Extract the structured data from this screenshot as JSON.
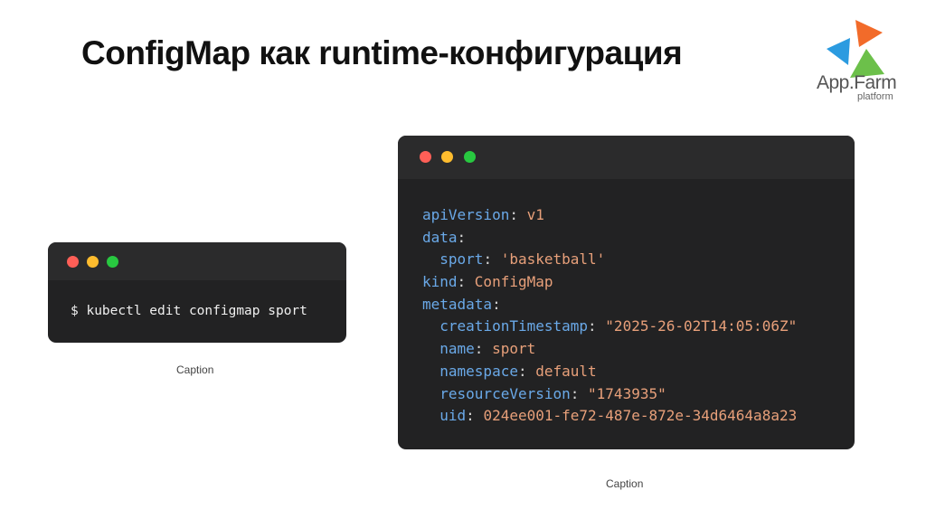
{
  "slide": {
    "title": "ConfigMap как runtime-конфигурация"
  },
  "logo": {
    "name": "App.Farm",
    "subtitle": "platform",
    "colors": {
      "orange": "#f26b2a",
      "blue": "#2b9be0",
      "green": "#6cc04a"
    }
  },
  "terminal": {
    "command": "$ kubectl edit configmap sport",
    "caption": "Caption"
  },
  "code_window": {
    "caption": "Caption",
    "lines": [
      {
        "indent": "",
        "key": "apiVersion",
        "sep": ": ",
        "value": "v1"
      },
      {
        "indent": "",
        "key": "data",
        "sep": ":",
        "value": ""
      },
      {
        "indent": "  ",
        "key": "sport",
        "sep": ": ",
        "value": "'basketball'"
      },
      {
        "indent": "",
        "key": "kind",
        "sep": ": ",
        "value": "ConfigMap"
      },
      {
        "indent": "",
        "key": "metadata",
        "sep": ":",
        "value": ""
      },
      {
        "indent": "  ",
        "key": "creationTimestamp",
        "sep": ": ",
        "value": "\"2025-26-02T14:05:06Z\""
      },
      {
        "indent": "  ",
        "key": "name",
        "sep": ": ",
        "value": "sport"
      },
      {
        "indent": "  ",
        "key": "namespace",
        "sep": ": ",
        "value": "default"
      },
      {
        "indent": "  ",
        "key": "resourceVersion",
        "sep": ": ",
        "value": "\"1743935\""
      },
      {
        "indent": "  ",
        "key": "uid",
        "sep": ": ",
        "value": "024ee001-fe72-487e-872e-34d6464a8a23"
      }
    ]
  },
  "colors": {
    "window_bg": "#222223",
    "key": "#6aa9e8",
    "value": "#e8a07a",
    "dot_red": "#ff5f57",
    "dot_yellow": "#febc2e",
    "dot_green": "#28c840"
  }
}
